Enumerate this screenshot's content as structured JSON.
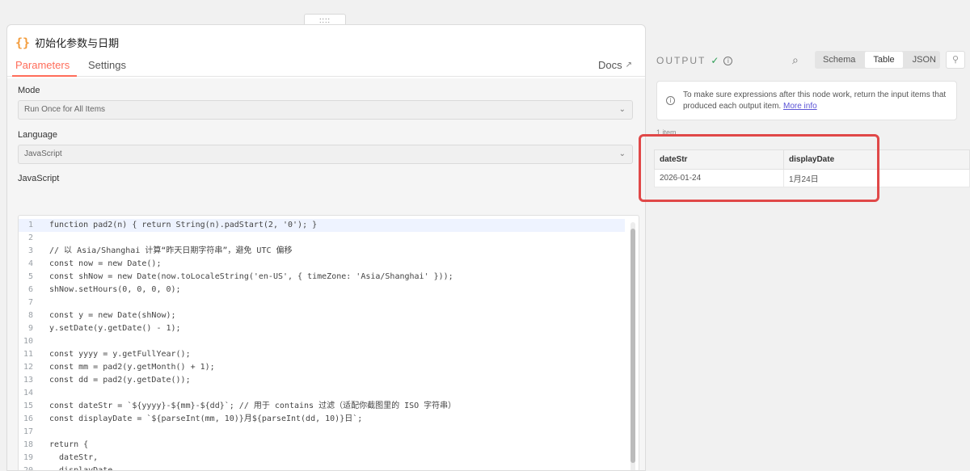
{
  "node": {
    "title": "初始化参数与日期",
    "icon": "braces-icon"
  },
  "tabs": [
    {
      "label": "Parameters",
      "active": true
    },
    {
      "label": "Settings",
      "active": false
    }
  ],
  "docs_label": "Docs",
  "drag_handle_glyph": "::::",
  "parameters": {
    "mode": {
      "label": "Mode",
      "value": "Run Once for All Items"
    },
    "language": {
      "label": "Language",
      "value": "JavaScript"
    },
    "code": {
      "label": "JavaScript",
      "lines": [
        "function pad2(n) { return String(n).padStart(2, '0'); }",
        "",
        "// 以 Asia/Shanghai 计算“昨天日期字符串”，避免 UTC 偏移",
        "const now = new Date();",
        "const shNow = new Date(now.toLocaleString('en-US', { timeZone: 'Asia/Shanghai' }));",
        "shNow.setHours(0, 0, 0, 0);",
        "",
        "const y = new Date(shNow);",
        "y.setDate(y.getDate() - 1);",
        "",
        "const yyyy = y.getFullYear();",
        "const mm = pad2(y.getMonth() + 1);",
        "const dd = pad2(y.getDate());",
        "",
        "const dateStr = `${yyyy}-${mm}-${dd}`; // 用于 contains 过滤（适配你截图里的 ISO 字符串）",
        "const displayDate = `${parseInt(mm, 10)}月${parseInt(dd, 10)}日`;",
        "",
        "return {",
        "  dateStr,",
        "  displayDate",
        "};"
      ]
    }
  },
  "output": {
    "label": "OUTPUT",
    "views": [
      "Schema",
      "Table",
      "JSON"
    ],
    "active_view": "Table",
    "notice": "To make sure expressions after this node work, return the input items that produced each output item.",
    "notice_link": "More info",
    "item_count": "1 item",
    "table": {
      "columns": [
        "dateStr",
        "displayDate"
      ],
      "rows": [
        [
          "2026-01-24",
          "1月24日"
        ]
      ]
    }
  },
  "colors": {
    "accent": "#ff6d5a",
    "highlight": "#e04848",
    "success": "#2e9e55",
    "link": "#5b54d6"
  }
}
